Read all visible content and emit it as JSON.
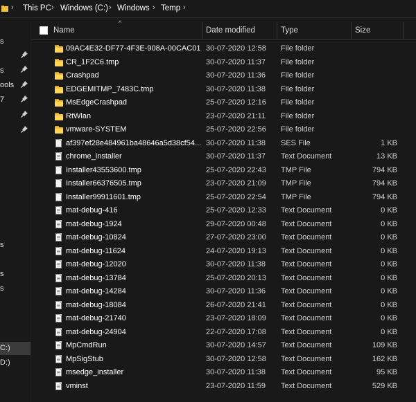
{
  "breadcrumb": {
    "items": [
      "This PC",
      "Windows (C:)",
      "Windows",
      "Temp"
    ]
  },
  "nav": {
    "fragments": [
      "s",
      "s",
      "ools",
      "7",
      "s",
      "s",
      "s",
      "C:)",
      "D:)"
    ]
  },
  "columns": {
    "name": "Name",
    "date": "Date modified",
    "type": "Type",
    "size": "Size"
  },
  "files": [
    {
      "name": "09AC4E32-DF77-4F3E-908A-00CAC01...",
      "date": "30-07-2020 12:58",
      "type": "File folder",
      "size": "",
      "icon": "folder-icon"
    },
    {
      "name": "CR_1F2C6.tmp",
      "date": "30-07-2020 11:37",
      "type": "File folder",
      "size": "",
      "icon": "folder-icon"
    },
    {
      "name": "Crashpad",
      "date": "30-07-2020 11:36",
      "type": "File folder",
      "size": "",
      "icon": "folder-icon"
    },
    {
      "name": "EDGEMITMP_7483C.tmp",
      "date": "30-07-2020 11:38",
      "type": "File folder",
      "size": "",
      "icon": "folder-icon"
    },
    {
      "name": "MsEdgeCrashpad",
      "date": "25-07-2020 12:16",
      "type": "File folder",
      "size": "",
      "icon": "folder-icon"
    },
    {
      "name": "RtWlan",
      "date": "23-07-2020 21:11",
      "type": "File folder",
      "size": "",
      "icon": "folder-icon"
    },
    {
      "name": "vmware-SYSTEM",
      "date": "25-07-2020 22:56",
      "type": "File folder",
      "size": "",
      "icon": "folder-icon"
    },
    {
      "name": "af397ef28e484961ba48646a5d38cf54...",
      "date": "30-07-2020 11:38",
      "type": "SES File",
      "size": "1 KB",
      "icon": "file-icon"
    },
    {
      "name": "chrome_installer",
      "date": "30-07-2020 11:37",
      "type": "Text Document",
      "size": "13 KB",
      "icon": "text-file-icon"
    },
    {
      "name": "Installer43553600.tmp",
      "date": "25-07-2020 22:43",
      "type": "TMP File",
      "size": "794 KB",
      "icon": "file-icon"
    },
    {
      "name": "Installer66376505.tmp",
      "date": "23-07-2020 21:09",
      "type": "TMP File",
      "size": "794 KB",
      "icon": "file-icon"
    },
    {
      "name": "Installer99911601.tmp",
      "date": "25-07-2020 22:54",
      "type": "TMP File",
      "size": "794 KB",
      "icon": "file-icon"
    },
    {
      "name": "mat-debug-416",
      "date": "25-07-2020 12:33",
      "type": "Text Document",
      "size": "0 KB",
      "icon": "text-file-icon"
    },
    {
      "name": "mat-debug-1924",
      "date": "29-07-2020 00:48",
      "type": "Text Document",
      "size": "0 KB",
      "icon": "text-file-icon"
    },
    {
      "name": "mat-debug-10824",
      "date": "27-07-2020 23:00",
      "type": "Text Document",
      "size": "0 KB",
      "icon": "text-file-icon"
    },
    {
      "name": "mat-debug-11624",
      "date": "24-07-2020 19:13",
      "type": "Text Document",
      "size": "0 KB",
      "icon": "text-file-icon"
    },
    {
      "name": "mat-debug-12020",
      "date": "30-07-2020 11:38",
      "type": "Text Document",
      "size": "0 KB",
      "icon": "text-file-icon"
    },
    {
      "name": "mat-debug-13784",
      "date": "25-07-2020 20:13",
      "type": "Text Document",
      "size": "0 KB",
      "icon": "text-file-icon"
    },
    {
      "name": "mat-debug-14284",
      "date": "30-07-2020 11:36",
      "type": "Text Document",
      "size": "0 KB",
      "icon": "text-file-icon"
    },
    {
      "name": "mat-debug-18084",
      "date": "26-07-2020 21:41",
      "type": "Text Document",
      "size": "0 KB",
      "icon": "text-file-icon"
    },
    {
      "name": "mat-debug-21740",
      "date": "23-07-2020 18:09",
      "type": "Text Document",
      "size": "0 KB",
      "icon": "text-file-icon"
    },
    {
      "name": "mat-debug-24904",
      "date": "22-07-2020 17:08",
      "type": "Text Document",
      "size": "0 KB",
      "icon": "text-file-icon"
    },
    {
      "name": "MpCmdRun",
      "date": "30-07-2020 14:57",
      "type": "Text Document",
      "size": "109 KB",
      "icon": "text-file-icon"
    },
    {
      "name": "MpSigStub",
      "date": "30-07-2020 12:58",
      "type": "Text Document",
      "size": "162 KB",
      "icon": "text-file-icon"
    },
    {
      "name": "msedge_installer",
      "date": "30-07-2020 11:38",
      "type": "Text Document",
      "size": "95 KB",
      "icon": "text-file-icon"
    },
    {
      "name": "vminst",
      "date": "23-07-2020 11:59",
      "type": "Text Document",
      "size": "529 KB",
      "icon": "text-file-icon"
    }
  ]
}
